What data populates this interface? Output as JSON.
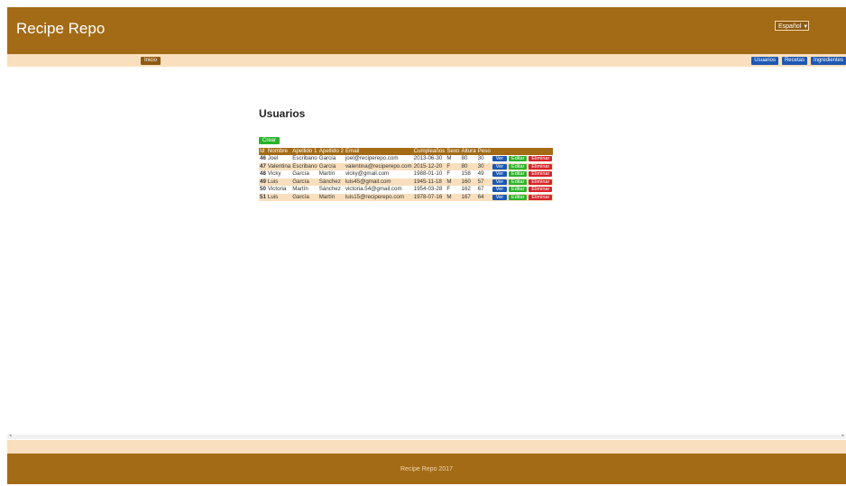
{
  "header": {
    "brand": "Recipe Repo",
    "language": "Español"
  },
  "nav": {
    "home": "Inicio",
    "links": [
      "Usuarios",
      "Recetas",
      "Ingredientes"
    ]
  },
  "page": {
    "title": "Usuarios",
    "create_label": "Crear"
  },
  "table": {
    "headers": [
      "Id",
      "Nombre",
      "Apellido 1",
      "Apellido 2",
      "Email",
      "Cumpleaños",
      "Sexo",
      "Altura",
      "Peso",
      "",
      "",
      ""
    ],
    "rows": [
      [
        "46",
        "Joel",
        "Escribano",
        "García",
        "joel@reciperepo.com",
        "2013-06-30",
        "M",
        "80",
        "30"
      ],
      [
        "47",
        "Valentina",
        "Escribano",
        "García",
        "valentina@reciperepo.com",
        "2015-12-20",
        "F",
        "80",
        "30"
      ],
      [
        "48",
        "Vicky",
        "García",
        "Martín",
        "vicky@gmail.com",
        "1988-01-10",
        "F",
        "158",
        "49"
      ],
      [
        "49",
        "Luis",
        "García",
        "Sánchez",
        "luis45@gmail.com",
        "1945-11-18",
        "M",
        "160",
        "57"
      ],
      [
        "50",
        "Victoria",
        "Martín",
        "Sánchez",
        "victoria.54@gmail.com",
        "1954-03-28",
        "F",
        "162",
        "67"
      ],
      [
        "51",
        "Luis",
        "García",
        "Martín",
        "luis15@reciperepo.com",
        "1978-07-16",
        "M",
        "167",
        "64"
      ]
    ],
    "actions": {
      "view": "Ver",
      "edit": "Editar",
      "delete": "Eliminar"
    }
  },
  "footer": {
    "text": "Recipe Repo 2017"
  }
}
